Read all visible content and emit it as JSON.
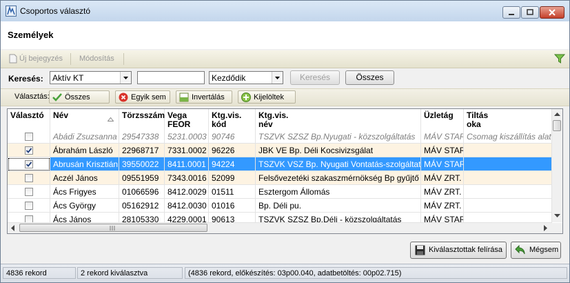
{
  "window": {
    "title": "Csoportos választó"
  },
  "header": {
    "title": "Személyek"
  },
  "toolbar": {
    "new_label": "Új bejegyzés",
    "edit_label": "Módosítás"
  },
  "search": {
    "label": "Keresés:",
    "field_value": "Aktív KT",
    "text_value": "",
    "mode_value": "Kezdődik",
    "search_button": "Keresés",
    "all_button": "Összes"
  },
  "selection": {
    "label": "Választás:",
    "all": "Összes",
    "none": "Egyik sem",
    "invert": "Invertálás",
    "selected": "Kijelöltek"
  },
  "grid": {
    "columns": [
      {
        "l1": "Választó",
        "l2": ""
      },
      {
        "l1": "Név",
        "l2": ""
      },
      {
        "l1": "Törzsszám",
        "l2": ""
      },
      {
        "l1": "Vega",
        "l2": "FEOR"
      },
      {
        "l1": "Ktg.vis.",
        "l2": "kód"
      },
      {
        "l1": "Ktg.vis.",
        "l2": "név"
      },
      {
        "l1": "Üzletág",
        "l2": ""
      },
      {
        "l1": "Tiltás",
        "l2": "oka"
      }
    ],
    "rows": [
      {
        "checked": false,
        "style": "disabled",
        "name": "Abádi Zsuzsanna",
        "id": "29547338",
        "feor": "5231.0003",
        "code": "90746",
        "costname": "TSZVK SZSZ Bp.Nyugati - közszolgáltatás",
        "branch": "MÁV START",
        "reason": "Csomag kiszállítás alatt"
      },
      {
        "checked": true,
        "style": "alt",
        "name": "Ábrahám László",
        "id": "22968717",
        "feor": "7331.0002",
        "code": "96226",
        "costname": "JBK VE Bp. Déli Kocsivizsgálat",
        "branch": "MÁV START",
        "reason": ""
      },
      {
        "checked": true,
        "style": "selected",
        "name": "Abrusán Krisztián",
        "id": "39550022",
        "feor": "8411.0001",
        "code": "94224",
        "costname": "TSZVK VSZ  Bp. Nyugati Vontatás-szolgáltatás",
        "branch": "MÁV START",
        "reason": ""
      },
      {
        "checked": false,
        "style": "alt",
        "name": "Aczél János",
        "id": "09551959",
        "feor": "7343.0016",
        "code": "52099",
        "costname": "Felsővezetéki szakaszmérnökség Bp gyűjtő kód",
        "branch": "MÁV ZRT.",
        "reason": ""
      },
      {
        "checked": false,
        "style": "normal",
        "name": "Ács Frigyes",
        "id": "01066596",
        "feor": "8412.0029",
        "code": "01511",
        "costname": "Esztergom Állomás",
        "branch": "MÁV ZRT.",
        "reason": ""
      },
      {
        "checked": false,
        "style": "normal",
        "name": "Ács György",
        "id": "05162912",
        "feor": "8412.0030",
        "code": "01016",
        "costname": "Bp. Déli pu.",
        "branch": "MÁV ZRT.",
        "reason": ""
      },
      {
        "checked": false,
        "style": "normal",
        "name": "Ács János",
        "id": "28105330",
        "feor": "4229.0001",
        "code": "90613",
        "costname": "TSZVK SZSZ Bp.Déli - közszolgáltatás",
        "branch": "MÁV START",
        "reason": ""
      }
    ]
  },
  "actions": {
    "save_selected": "Kiválasztottak felírása",
    "cancel": "Mégsem"
  },
  "status": {
    "records": "4836 rekord",
    "selected": "2 rekord kiválasztva",
    "detail": "(4836 rekord, előkészítés: 03p00.040, adatbetöltés: 00p02.715)"
  },
  "colors": {
    "selected_row": "#3399ff",
    "alt_row": "#fdf3e2",
    "disabled_text": "#7f7f7f"
  }
}
